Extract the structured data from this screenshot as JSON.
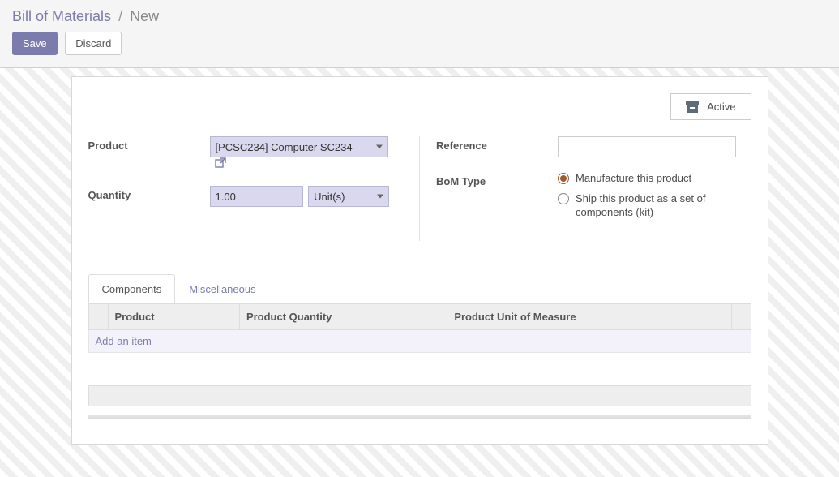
{
  "breadcrumb": {
    "root": "Bill of Materials",
    "current": "New"
  },
  "actions": {
    "save": "Save",
    "discard": "Discard"
  },
  "ribbon": {
    "active": "Active"
  },
  "labels": {
    "product": "Product",
    "quantity": "Quantity",
    "reference": "Reference",
    "bom_type": "BoM Type"
  },
  "fields": {
    "product": "[PCSC234] Computer SC234",
    "qty": "1.00",
    "unit": "Unit(s)",
    "reference": ""
  },
  "bom_types": {
    "manufacture": "Manufacture this product",
    "kit": "Ship this product as a set of components (kit)",
    "selected": "manufacture"
  },
  "tabs": {
    "components": "Components",
    "misc": "Miscellaneous",
    "active": "components"
  },
  "grid": {
    "headers": {
      "product": "Product",
      "qty": "Product Quantity",
      "uom": "Product Unit of Measure"
    },
    "add_item": "Add an item"
  }
}
